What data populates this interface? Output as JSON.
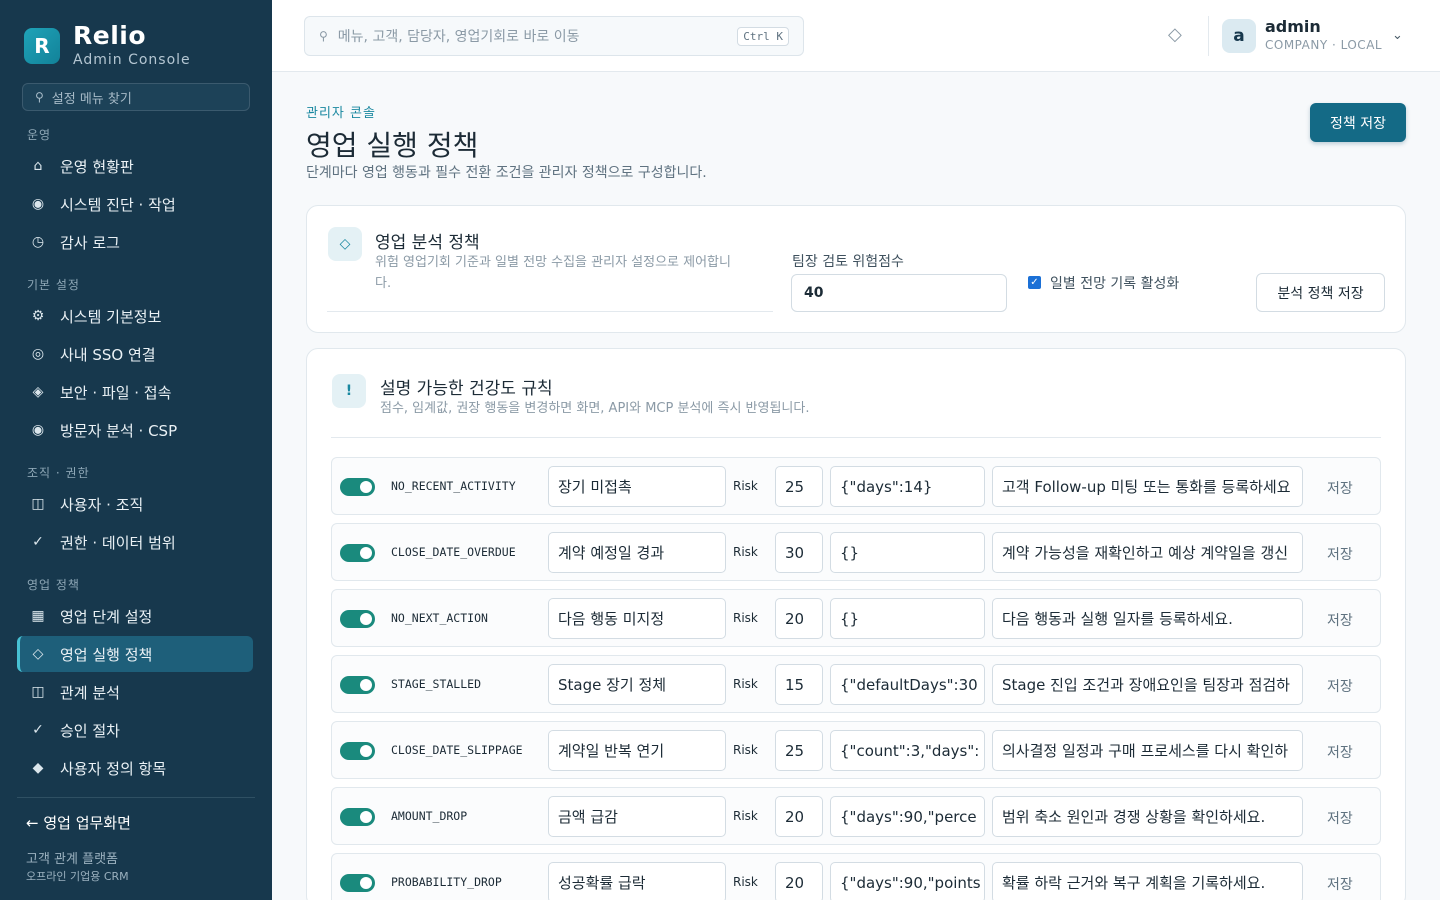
{
  "brand": {
    "logo_letter": "R",
    "name": "Relio",
    "subtitle": "Admin Console"
  },
  "sidebar": {
    "search_placeholder": "설정 메뉴 찾기",
    "groups": [
      {
        "label": "운영",
        "items": [
          {
            "icon": "⌂",
            "label": "운영 현황판"
          },
          {
            "icon": "◉",
            "label": "시스템 진단 · 작업"
          },
          {
            "icon": "◷",
            "label": "감사 로그"
          }
        ]
      },
      {
        "label": "기본 설정",
        "items": [
          {
            "icon": "⚙",
            "label": "시스템 기본정보"
          },
          {
            "icon": "◎",
            "label": "사내 SSO 연결"
          },
          {
            "icon": "◈",
            "label": "보안 · 파일 · 접속"
          },
          {
            "icon": "◉",
            "label": "방문자 분석 · CSP"
          }
        ]
      },
      {
        "label": "조직 · 권한",
        "items": [
          {
            "icon": "◫",
            "label": "사용자 · 조직"
          },
          {
            "icon": "✓",
            "label": "권한 · 데이터 범위"
          }
        ]
      },
      {
        "label": "영업 정책",
        "items": [
          {
            "icon": "▦",
            "label": "영업 단계 설정"
          },
          {
            "icon": "◇",
            "label": "영업 실행 정책"
          },
          {
            "icon": "◫",
            "label": "관계 분석"
          },
          {
            "icon": "✓",
            "label": "승인 절차"
          },
          {
            "icon": "◆",
            "label": "사용자 정의 항목"
          }
        ]
      }
    ],
    "back_link": "← 영업 업무화면",
    "footer_line1": "고객 관계 플랫폼",
    "footer_line2": "오프라인 기업용 CRM"
  },
  "header": {
    "search_placeholder": "메뉴, 고객, 담당자, 영업기회로 바로 이동",
    "shortcut": "Ctrl K",
    "notification_icon": "◇",
    "user": {
      "avatar_letter": "a",
      "name": "admin",
      "org": "COMPANY · LOCAL"
    },
    "chevron": "⌄"
  },
  "page": {
    "breadcrumb": "관리자 콘솔",
    "title": "영업 실행 정책",
    "description": "단계마다 영업 행동과 필수 전환 조건을 관리자 정책으로 구성합니다.",
    "save_button": "정책 저장"
  },
  "analysis_card": {
    "icon": "◇",
    "title": "영업 분석 정책",
    "desc_line1": "위험 영업기회 기준과 일별 전망 수집을 관리자 설정으로 제어합니",
    "desc_line2": "다.",
    "field_label": "팀장 검토 위험점수",
    "field_value": "40",
    "checkbox_label": "일별 전망 기록 활성화",
    "checkbox_checked": true,
    "save_button": "분석 정책 저장"
  },
  "rules_card": {
    "icon": "!",
    "title": "설명 가능한 건강도 규칙",
    "description": "점수, 임계값, 권장 행동을 변경하면 화면, API와 MCP 분석에 즉시 반영됩니다.",
    "risk_label": "Risk",
    "save_label": "저장",
    "rules": [
      {
        "code": "NO_RECENT_ACTIVITY",
        "name": "장기 미접촉",
        "score": "25",
        "params": "{\"days\":14}",
        "action": "고객 Follow-up 미팅 또는 통화를 등록하세요",
        "enabled": true
      },
      {
        "code": "CLOSE_DATE_OVERDUE",
        "name": "계약 예정일 경과",
        "score": "30",
        "params": "{}",
        "action": "계약 가능성을 재확인하고 예상 계약일을 갱신",
        "enabled": true
      },
      {
        "code": "NO_NEXT_ACTION",
        "name": "다음 행동 미지정",
        "score": "20",
        "params": "{}",
        "action": "다음 행동과 실행 일자를 등록하세요.",
        "enabled": true
      },
      {
        "code": "STAGE_STALLED",
        "name": "Stage 장기 정체",
        "score": "15",
        "params": "{\"defaultDays\":30",
        "action": "Stage 진입 조건과 장애요인을 팀장과 점검하",
        "enabled": true
      },
      {
        "code": "CLOSE_DATE_SLIPPAGE",
        "name": "계약일 반복 연기",
        "score": "25",
        "params": "{\"count\":3,\"days\":",
        "action": "의사결정 일정과 구매 프로세스를 다시 확인하",
        "enabled": true
      },
      {
        "code": "AMOUNT_DROP",
        "name": "금액 급감",
        "score": "20",
        "params": "{\"days\":90,\"perce",
        "action": "범위 축소 원인과 경쟁 상황을 확인하세요.",
        "enabled": true
      },
      {
        "code": "PROBABILITY_DROP",
        "name": "성공확률 급락",
        "score": "20",
        "params": "{\"days\":90,\"points",
        "action": "확률 하락 근거와 복구 계획을 기록하세요.",
        "enabled": true
      }
    ]
  },
  "colors": {
    "sidebar_bg": "#17384d",
    "accent": "#1a88a0",
    "primary_button": "#146a86",
    "toggle_on": "#1a8a7d"
  }
}
